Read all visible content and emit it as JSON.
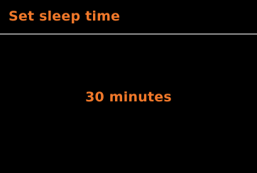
{
  "header": {
    "title": "Set sleep time"
  },
  "main": {
    "sleep_value": "30 minutes"
  },
  "colors": {
    "background": "#000000",
    "text_accent": "#f0782a",
    "divider": "#8c8c8c"
  }
}
